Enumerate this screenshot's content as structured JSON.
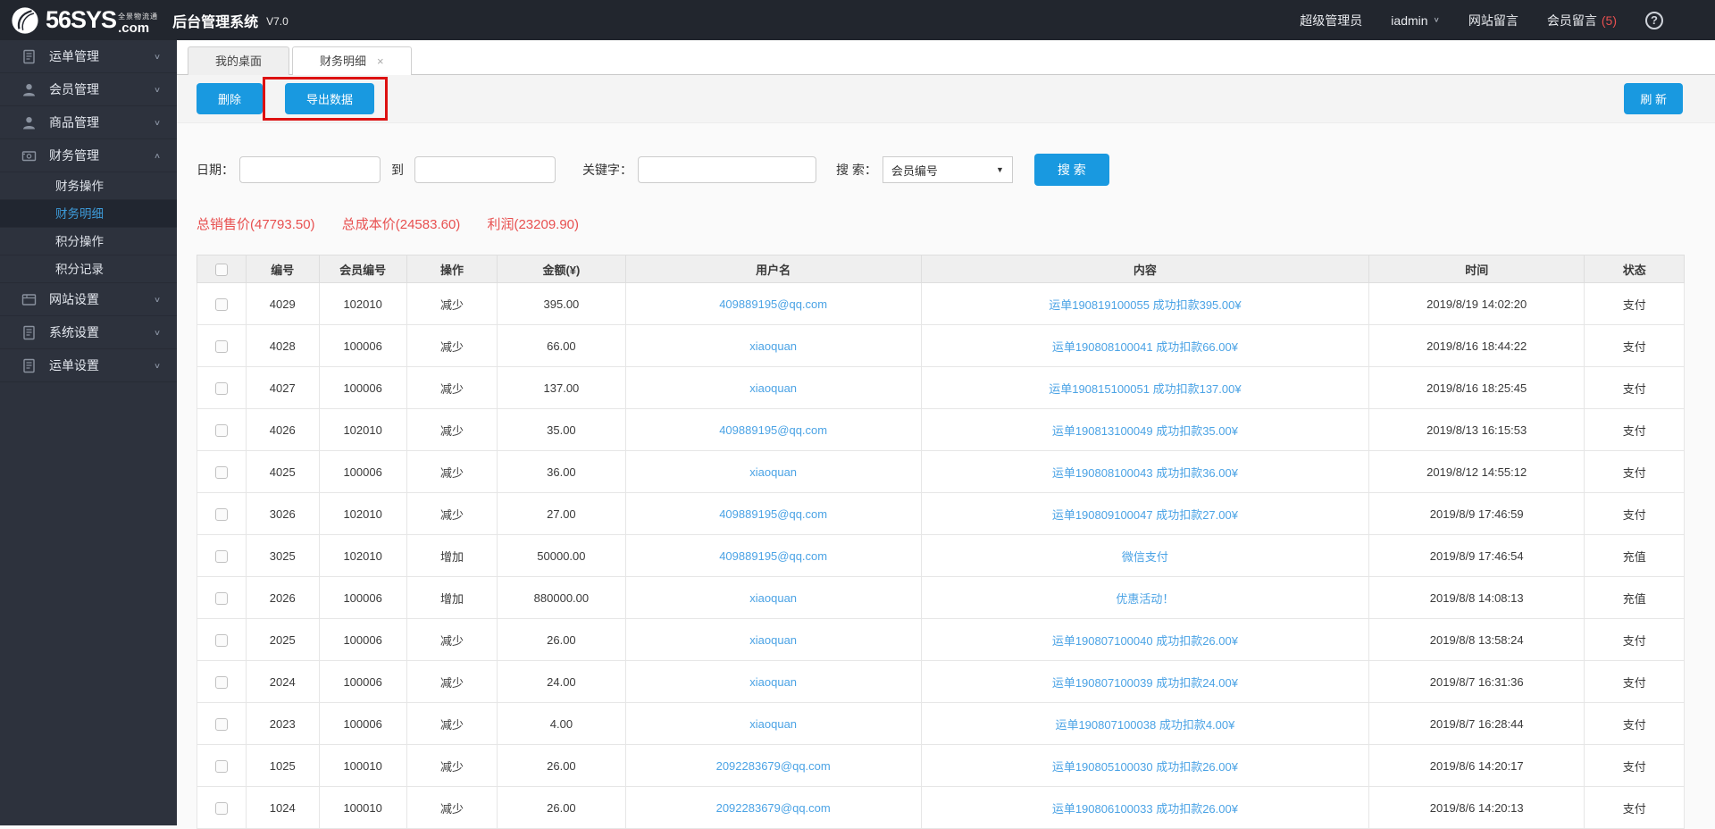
{
  "header": {
    "logo_main": "56SYS",
    "logo_tagline": "全景物流通",
    "logo_domain": ".com",
    "app_title": "后台管理系统",
    "version": "V7.0",
    "role": "超级管理员",
    "username": "iadmin",
    "nav_site_msg": "网站留言",
    "nav_member_msg": "会员留言",
    "member_msg_count": "(5)",
    "help_glyph": "?"
  },
  "sidebar": {
    "items": [
      {
        "label": "运单管理",
        "icon": "waybill-icon",
        "expanded": false
      },
      {
        "label": "会员管理",
        "icon": "member-icon",
        "expanded": false
      },
      {
        "label": "商品管理",
        "icon": "product-icon",
        "expanded": false
      },
      {
        "label": "财务管理",
        "icon": "finance-icon",
        "expanded": true,
        "children": [
          {
            "label": "财务操作",
            "active": false
          },
          {
            "label": "财务明细",
            "active": true
          },
          {
            "label": "积分操作",
            "active": false
          },
          {
            "label": "积分记录",
            "active": false
          }
        ]
      },
      {
        "label": "网站设置",
        "icon": "website-icon",
        "expanded": false
      },
      {
        "label": "系统设置",
        "icon": "system-icon",
        "expanded": false
      },
      {
        "label": "运单设置",
        "icon": "waybill-icon",
        "expanded": false
      }
    ]
  },
  "tabs": [
    {
      "label": "我的桌面",
      "active": false,
      "closable": false
    },
    {
      "label": "财务明细",
      "active": true,
      "closable": true,
      "close_glyph": "×"
    }
  ],
  "toolbar": {
    "delete": "删除",
    "export": "导出数据",
    "refresh": "刷 新"
  },
  "filters": {
    "date_label": "日期：",
    "to_label": "到",
    "keyword_label": "关键字：",
    "search_by_label": "搜 索：",
    "search_by_value": "会员编号",
    "search_button": "搜 索",
    "date_from_value": "",
    "date_to_value": "",
    "keyword_value": ""
  },
  "summary": {
    "total_sale": "总销售价(47793.50)",
    "total_cost": "总成本价(24583.60)",
    "profit": "利润(23209.90)"
  },
  "table": {
    "headers": [
      "编号",
      "会员编号",
      "操作",
      "金额(¥)",
      "用户名",
      "内容",
      "时间",
      "状态"
    ],
    "rows": [
      {
        "id": "4029",
        "member_id": "102010",
        "op": "减少",
        "amount": "395.00",
        "username": "409889195@qq.com",
        "content": "运单190819100055 成功扣款395.00¥",
        "time": "2019/8/19 14:02:20",
        "status": "支付"
      },
      {
        "id": "4028",
        "member_id": "100006",
        "op": "减少",
        "amount": "66.00",
        "username": "xiaoquan",
        "content": "运单190808100041 成功扣款66.00¥",
        "time": "2019/8/16 18:44:22",
        "status": "支付"
      },
      {
        "id": "4027",
        "member_id": "100006",
        "op": "减少",
        "amount": "137.00",
        "username": "xiaoquan",
        "content": "运单190815100051 成功扣款137.00¥",
        "time": "2019/8/16 18:25:45",
        "status": "支付"
      },
      {
        "id": "4026",
        "member_id": "102010",
        "op": "减少",
        "amount": "35.00",
        "username": "409889195@qq.com",
        "content": "运单190813100049 成功扣款35.00¥",
        "time": "2019/8/13 16:15:53",
        "status": "支付"
      },
      {
        "id": "4025",
        "member_id": "100006",
        "op": "减少",
        "amount": "36.00",
        "username": "xiaoquan",
        "content": "运单190808100043 成功扣款36.00¥",
        "time": "2019/8/12 14:55:12",
        "status": "支付"
      },
      {
        "id": "3026",
        "member_id": "102010",
        "op": "减少",
        "amount": "27.00",
        "username": "409889195@qq.com",
        "content": "运单190809100047 成功扣款27.00¥",
        "time": "2019/8/9 17:46:59",
        "status": "支付"
      },
      {
        "id": "3025",
        "member_id": "102010",
        "op": "增加",
        "amount": "50000.00",
        "username": "409889195@qq.com",
        "content": "微信支付",
        "time": "2019/8/9 17:46:54",
        "status": "充值"
      },
      {
        "id": "2026",
        "member_id": "100006",
        "op": "增加",
        "amount": "880000.00",
        "username": "xiaoquan",
        "content": "优惠活动！",
        "time": "2019/8/8 14:08:13",
        "status": "充值"
      },
      {
        "id": "2025",
        "member_id": "100006",
        "op": "减少",
        "amount": "26.00",
        "username": "xiaoquan",
        "content": "运单190807100040 成功扣款26.00¥",
        "time": "2019/8/8 13:58:24",
        "status": "支付"
      },
      {
        "id": "2024",
        "member_id": "100006",
        "op": "减少",
        "amount": "24.00",
        "username": "xiaoquan",
        "content": "运单190807100039 成功扣款24.00¥",
        "time": "2019/8/7 16:31:36",
        "status": "支付"
      },
      {
        "id": "2023",
        "member_id": "100006",
        "op": "减少",
        "amount": "4.00",
        "username": "xiaoquan",
        "content": "运单190807100038 成功扣款4.00¥",
        "time": "2019/8/7 16:28:44",
        "status": "支付"
      },
      {
        "id": "1025",
        "member_id": "100010",
        "op": "减少",
        "amount": "26.00",
        "username": "2092283679@qq.com",
        "content": "运单190805100030 成功扣款26.00¥",
        "time": "2019/8/6 14:20:17",
        "status": "支付"
      },
      {
        "id": "1024",
        "member_id": "100010",
        "op": "减少",
        "amount": "26.00",
        "username": "2092283679@qq.com",
        "content": "运单190806100033 成功扣款26.00¥",
        "time": "2019/8/6 14:20:13",
        "status": "支付"
      }
    ]
  },
  "colors": {
    "header_dark": "#22262e",
    "sidebar_dark": "#2d323d",
    "accent_blue": "#1999e0",
    "link_blue": "#4ba3e5",
    "alert_red": "#e85050",
    "highlight_box_red": "#dd1111",
    "active_item_blue": "#3d9ad8"
  }
}
